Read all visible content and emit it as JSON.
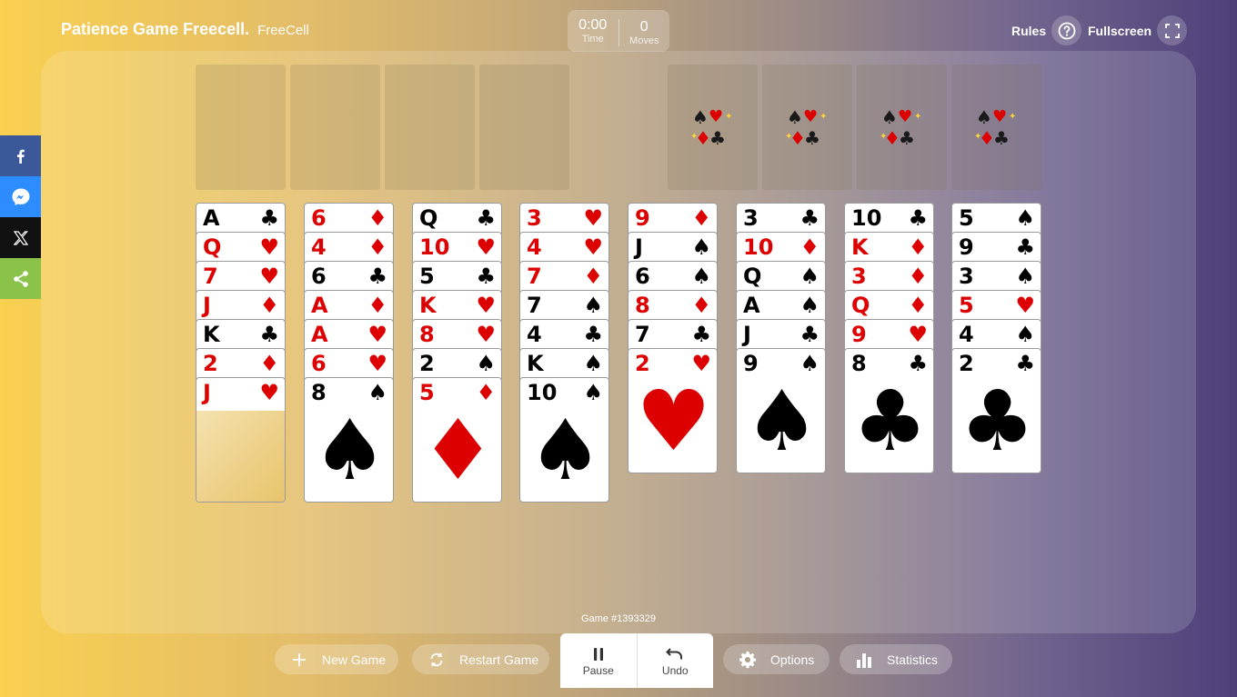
{
  "header": {
    "brand": "Patience Game Freecell.",
    "brand_sub": "FreeCell",
    "time_value": "0:00",
    "time_label": "Time",
    "moves_value": "0",
    "moves_label": "Moves",
    "rules_label": "Rules",
    "fullscreen_label": "Fullscreen"
  },
  "share": [
    "facebook-icon",
    "messenger-icon",
    "x-icon",
    "share-icon"
  ],
  "free_cells": 4,
  "foundations": 4,
  "columns": [
    [
      {
        "r": "A",
        "s": "♣"
      },
      {
        "r": "Q",
        "s": "♥"
      },
      {
        "r": "7",
        "s": "♥"
      },
      {
        "r": "J",
        "s": "♦"
      },
      {
        "r": "K",
        "s": "♣"
      },
      {
        "r": "2",
        "s": "♦"
      },
      {
        "r": "J",
        "s": "♥"
      }
    ],
    [
      {
        "r": "6",
        "s": "♦"
      },
      {
        "r": "4",
        "s": "♦"
      },
      {
        "r": "6",
        "s": "♣"
      },
      {
        "r": "A",
        "s": "♦"
      },
      {
        "r": "A",
        "s": "♥"
      },
      {
        "r": "6",
        "s": "♥"
      },
      {
        "r": "8",
        "s": "♠"
      }
    ],
    [
      {
        "r": "Q",
        "s": "♣"
      },
      {
        "r": "10",
        "s": "♥"
      },
      {
        "r": "5",
        "s": "♣"
      },
      {
        "r": "K",
        "s": "♥"
      },
      {
        "r": "8",
        "s": "♥"
      },
      {
        "r": "2",
        "s": "♠"
      },
      {
        "r": "5",
        "s": "♦"
      }
    ],
    [
      {
        "r": "3",
        "s": "♥"
      },
      {
        "r": "4",
        "s": "♥"
      },
      {
        "r": "7",
        "s": "♦"
      },
      {
        "r": "7",
        "s": "♠"
      },
      {
        "r": "4",
        "s": "♣"
      },
      {
        "r": "K",
        "s": "♠"
      },
      {
        "r": "10",
        "s": "♠"
      }
    ],
    [
      {
        "r": "9",
        "s": "♦"
      },
      {
        "r": "J",
        "s": "♠"
      },
      {
        "r": "6",
        "s": "♠"
      },
      {
        "r": "8",
        "s": "♦"
      },
      {
        "r": "7",
        "s": "♣"
      },
      {
        "r": "2",
        "s": "♥"
      }
    ],
    [
      {
        "r": "3",
        "s": "♣"
      },
      {
        "r": "10",
        "s": "♦"
      },
      {
        "r": "Q",
        "s": "♠"
      },
      {
        "r": "A",
        "s": "♠"
      },
      {
        "r": "J",
        "s": "♣"
      },
      {
        "r": "9",
        "s": "♠"
      }
    ],
    [
      {
        "r": "10",
        "s": "♣"
      },
      {
        "r": "K",
        "s": "♦"
      },
      {
        "r": "3",
        "s": "♦"
      },
      {
        "r": "Q",
        "s": "♦"
      },
      {
        "r": "9",
        "s": "♥"
      },
      {
        "r": "8",
        "s": "♣"
      }
    ],
    [
      {
        "r": "5",
        "s": "♠"
      },
      {
        "r": "9",
        "s": "♣"
      },
      {
        "r": "3",
        "s": "♠"
      },
      {
        "r": "5",
        "s": "♥"
      },
      {
        "r": "4",
        "s": "♠"
      },
      {
        "r": "2",
        "s": "♣"
      }
    ]
  ],
  "game_number": "Game #1393329",
  "toolbar": {
    "new_game": "New Game",
    "restart_game": "Restart Game",
    "pause": "Pause",
    "undo": "Undo",
    "options": "Options",
    "statistics": "Statistics"
  }
}
